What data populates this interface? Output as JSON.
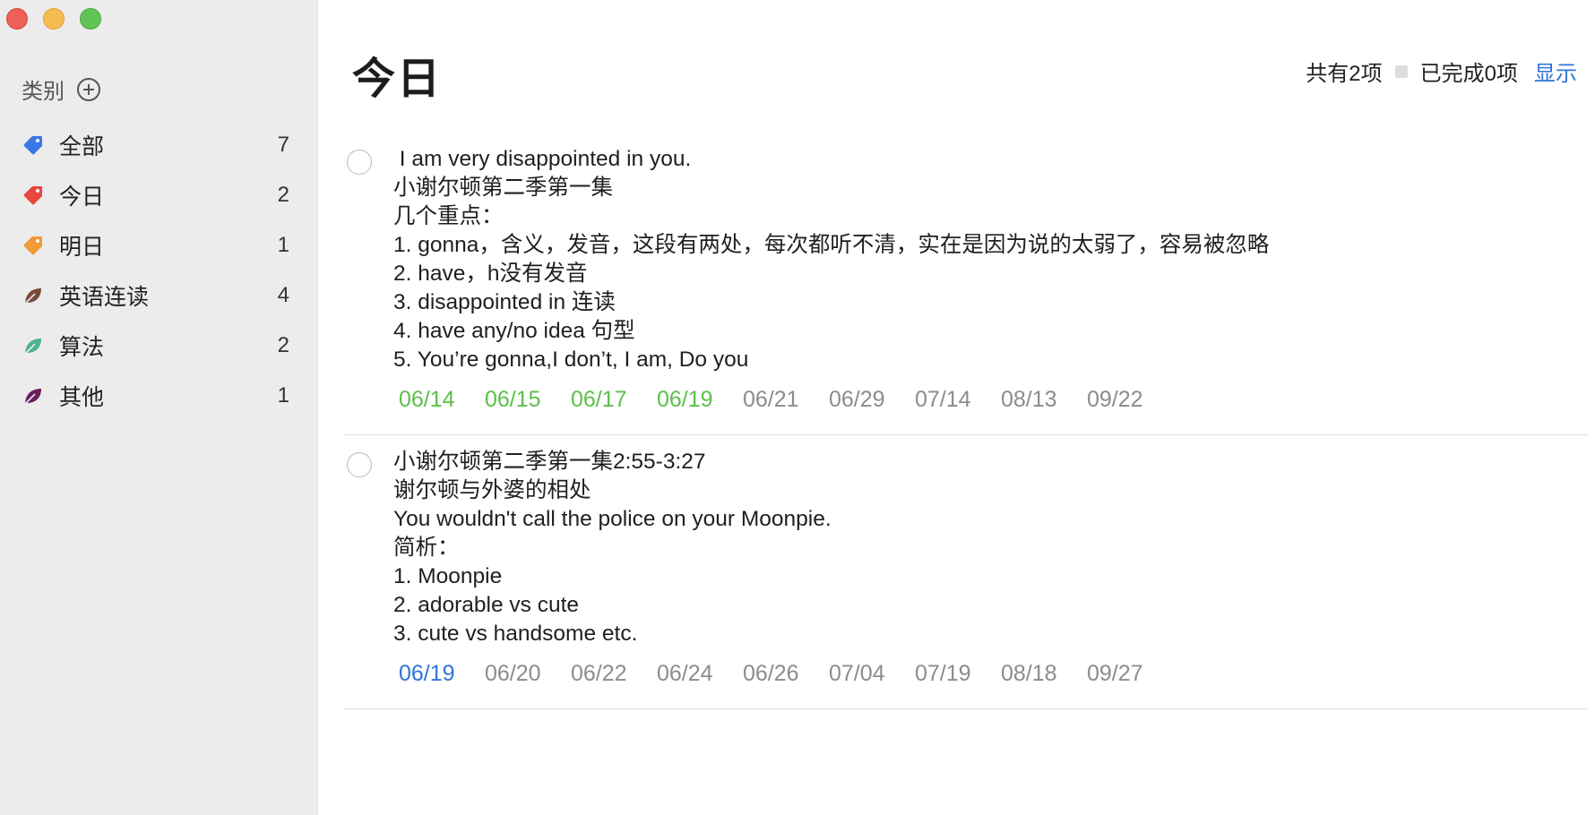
{
  "sidebar": {
    "header_label": "类别",
    "items": [
      {
        "label": "全部",
        "count": "7",
        "icon": "tag-icon",
        "color": "#3b78e7"
      },
      {
        "label": "今日",
        "count": "2",
        "icon": "tag-icon",
        "color": "#e8473f"
      },
      {
        "label": "明日",
        "count": "1",
        "icon": "tag-icon",
        "color": "#f19a38"
      },
      {
        "label": "英语连读",
        "count": "4",
        "icon": "leaf-icon",
        "color": "#7a4a3a"
      },
      {
        "label": "算法",
        "count": "2",
        "icon": "leaf-icon",
        "color": "#4fb38b"
      },
      {
        "label": "其他",
        "count": "1",
        "icon": "leaf-icon",
        "color": "#6b1f5e"
      }
    ]
  },
  "main": {
    "title": "今日",
    "summary": {
      "total": "共有2项",
      "completed": "已完成0项",
      "show": "显示"
    },
    "tasks": [
      {
        "lines": [
          " I am very disappointed in you.",
          "小谢尔顿第二季第一集",
          "几个重点：",
          "1. gonna，含义，发音，这段有两处，每次都听不清，实在是因为说的太弱了，容易被忽略",
          "2. have，h没有发音",
          "3. disappointed in 连读",
          "4. have any/no idea 句型",
          "5. You’re gonna,I don’t, I am, Do you"
        ],
        "dates": [
          "06/14",
          "06/15",
          "06/17",
          "06/19",
          "06/21",
          "06/29",
          "07/14",
          "08/13",
          "09/22"
        ],
        "date_states": [
          "done",
          "done",
          "done",
          "done",
          "future",
          "future",
          "future",
          "future",
          "future"
        ]
      },
      {
        "lines": [
          "小谢尔顿第二季第一集2:55-3:27",
          "谢尔顿与外婆的相处",
          "You wouldn't call the police on your Moonpie.",
          "简析：",
          "1. Moonpie",
          "2. adorable vs cute",
          "3. cute vs handsome etc."
        ],
        "dates": [
          "06/19",
          "06/20",
          "06/22",
          "06/24",
          "06/26",
          "07/04",
          "07/19",
          "08/18",
          "09/27"
        ],
        "date_states": [
          "current",
          "future",
          "future",
          "future",
          "future",
          "future",
          "future",
          "future",
          "future"
        ]
      }
    ]
  },
  "colors": {
    "done": "#5cbf4a",
    "current": "#2f73d9",
    "future": "#8c8c8c",
    "link": "#2f73d9"
  }
}
